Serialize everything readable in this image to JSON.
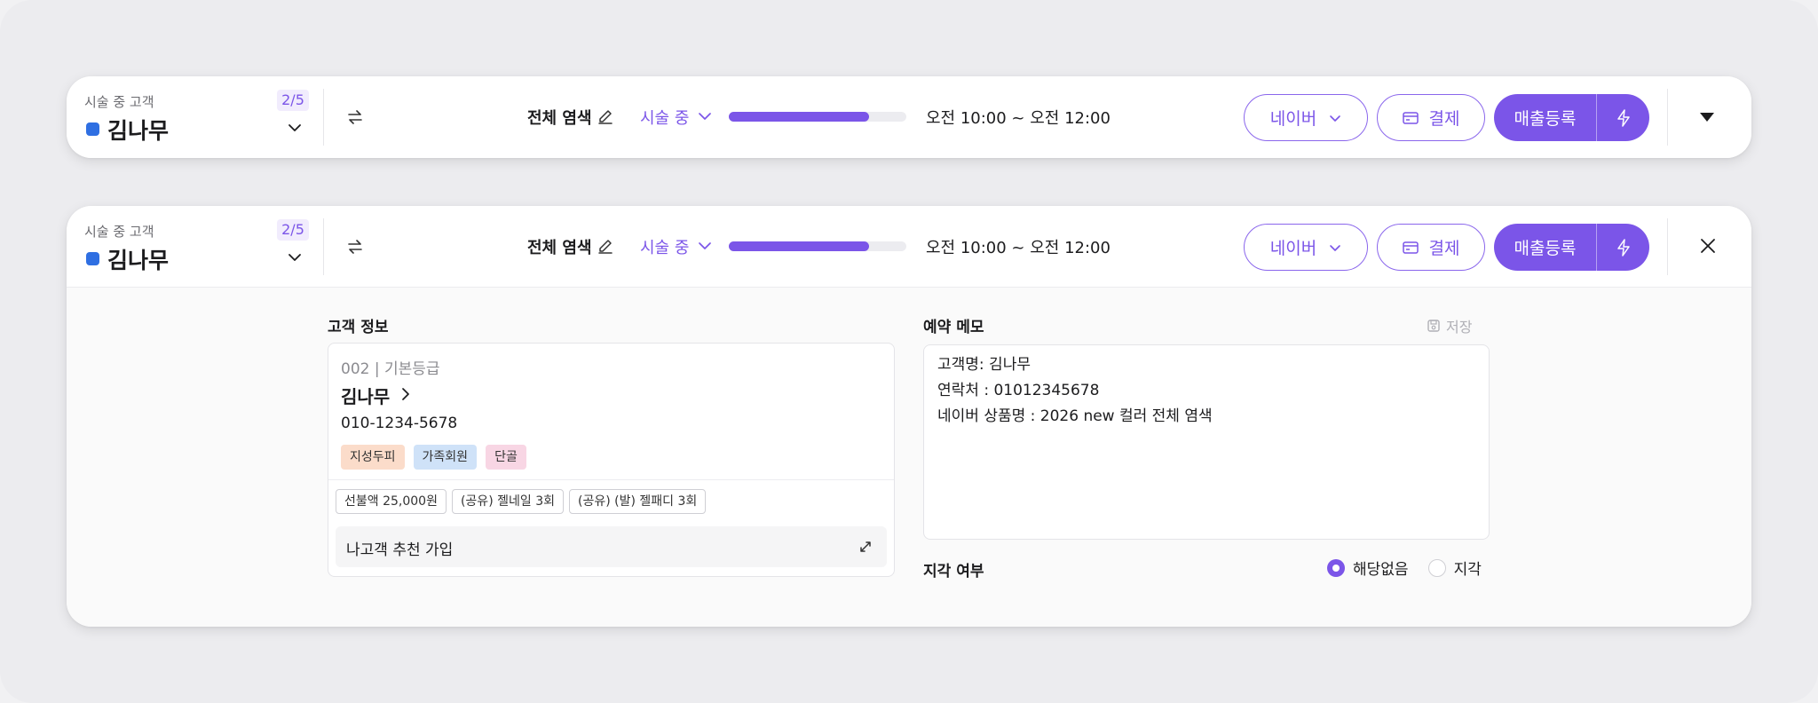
{
  "bar": {
    "customer_label": "시술 중 고객",
    "customer_count": "2/5",
    "customer_name": "김나무",
    "service_name": "전체 염색",
    "status": "시술 중",
    "progress_fraction": 0.79,
    "time_range": "오전 10:00 ~ 오전 12:00",
    "naver_button": "네이버",
    "pay_button": "결제",
    "sales_button": "매출등록"
  },
  "customer_info": {
    "section_title": "고객 정보",
    "grade": "002 | 기본등급",
    "name": "김나무",
    "phone": "010-1234-5678",
    "tags": [
      "지성두피",
      "가족회원",
      "단골"
    ],
    "chips": [
      "선불액 25,000원",
      "(공유) 젤네일 3회",
      "(공유) (발) 젤패디 3회"
    ],
    "referral": "나고객 추천 가입"
  },
  "memo": {
    "section_title": "예약 메모",
    "save_label": "저장",
    "lines": [
      "고객명: 김나무",
      "연락처 : 01012345678",
      "네이버 상품명 : 2026 new 컬러 전체 염색"
    ]
  },
  "late": {
    "section_title": "지각 여부",
    "options": [
      "해당없음",
      "지각"
    ],
    "selected": "해당없음"
  },
  "colors": {
    "accent": "#7b55e8",
    "customer_dot": "#2f6fe2",
    "tag_colors": [
      "#fbdcca",
      "#cfe2f8",
      "#f8d6e4"
    ]
  }
}
